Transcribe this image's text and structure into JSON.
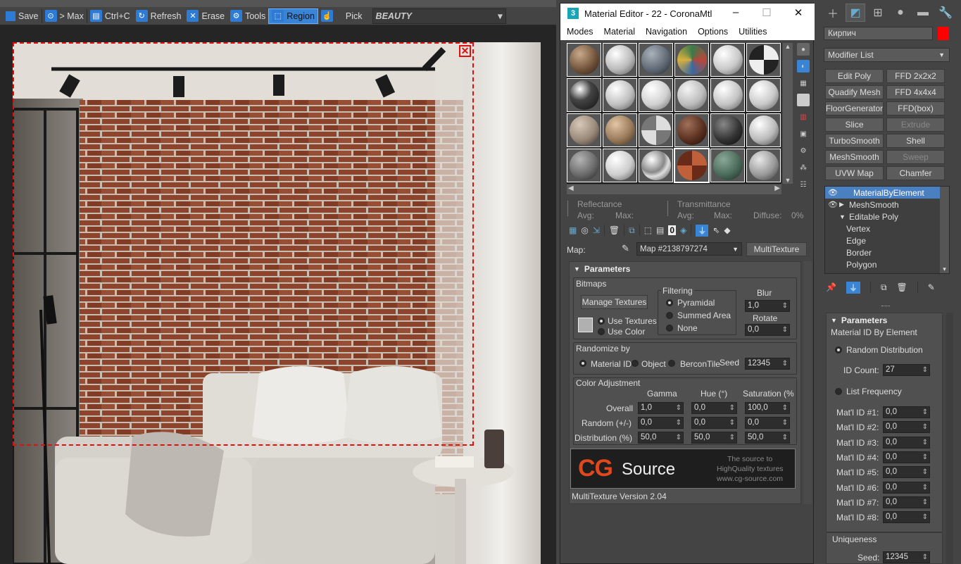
{
  "frame_buffer": {
    "toolbar": [
      {
        "label": "Save",
        "icon": "save-icon"
      },
      {
        "label": "> Max",
        "icon": "max-icon"
      },
      {
        "label": "Ctrl+C",
        "icon": "copy-icon"
      },
      {
        "label": "Refresh",
        "icon": "refresh-icon"
      },
      {
        "label": "Erase",
        "icon": "erase-icon"
      },
      {
        "label": "Tools",
        "icon": "tools-icon"
      },
      {
        "label": "Region",
        "icon": "region-icon",
        "selected": true
      },
      {
        "label": "Pick",
        "icon": "pick-icon"
      }
    ],
    "channel": "BEAUTY"
  },
  "material_editor": {
    "title": "Material Editor - 22 - CoronaMtl",
    "app_icon": "3",
    "menu": [
      "Modes",
      "Material",
      "Navigation",
      "Options",
      "Utilities"
    ],
    "reflectance": {
      "label": "Reflectance",
      "avg": "Avg:",
      "max": "Max:"
    },
    "transmittance": {
      "label": "Transmittance",
      "avg": "Avg:",
      "max": "Max:",
      "diffuse": "Diffuse:",
      "diffuse_val": "0%"
    },
    "map_label": "Map:",
    "map_name": "Map #2138797274",
    "map_type": "MultiTexture",
    "params": {
      "title": "Parameters",
      "bitmaps": "Bitmaps",
      "manage_textures": "Manage Textures",
      "use_textures": "Use Textures",
      "use_color": "Use Color",
      "filtering": "Filtering",
      "pyramidal": "Pyramidal",
      "summed_area": "Summed Area",
      "none": "None",
      "blur_label": "Blur",
      "blur": "1,0",
      "rotate_label": "Rotate",
      "rotate": "0,0",
      "randomize_by": "Randomize by",
      "material_id": "Material ID",
      "object": "Object",
      "bercontile": "BerconTile",
      "seed_label": "Seed",
      "seed": "12345",
      "color_adjustment": "Color Adjustment",
      "col_gamma": "Gamma",
      "col_hue": "Hue (°)",
      "col_sat": "Saturation (%",
      "rows": [
        {
          "label": "Overall",
          "g": "1,0",
          "h": "0,0",
          "s": "100,0"
        },
        {
          "label": "Random (+/-)",
          "g": "0,0",
          "h": "0,0",
          "s": "0,0"
        },
        {
          "label": "Distribution (%)",
          "g": "50,0",
          "h": "50,0",
          "s": "50,0"
        }
      ],
      "logo_cg": "CG",
      "logo_source": "Source",
      "logo_line1": "The source to",
      "logo_line2": "HighQuality textures",
      "logo_line3": "www.cg-source.com",
      "version": "MultiTexture Version 2.04"
    }
  },
  "command_panel": {
    "object_name": "Кирпич",
    "object_color": "#ff0000",
    "modifier_list": "Modifier List",
    "modifier_buttons": [
      {
        "label": "Edit Poly",
        "enabled": true
      },
      {
        "label": "FFD 2x2x2",
        "enabled": true
      },
      {
        "label": "Quadify Mesh",
        "enabled": true
      },
      {
        "label": "FFD 4x4x4",
        "enabled": true
      },
      {
        "label": "FloorGenerator",
        "enabled": true
      },
      {
        "label": "FFD(box)",
        "enabled": true
      },
      {
        "label": "Slice",
        "enabled": true
      },
      {
        "label": "Extrude",
        "enabled": false
      },
      {
        "label": "TurboSmooth",
        "enabled": true
      },
      {
        "label": "Shell",
        "enabled": true
      },
      {
        "label": "MeshSmooth",
        "enabled": true
      },
      {
        "label": "Sweep",
        "enabled": false
      },
      {
        "label": "UVW Map",
        "enabled": true
      },
      {
        "label": "Chamfer",
        "enabled": true
      }
    ],
    "stack": [
      {
        "label": "MaterialByElement",
        "level": 0,
        "selected": true,
        "eye": true
      },
      {
        "label": "MeshSmooth",
        "level": 0,
        "eye": true,
        "arrow": "▶"
      },
      {
        "label": "Editable Poly",
        "level": 0,
        "arrow": "▼"
      },
      {
        "label": "Vertex",
        "level": 1
      },
      {
        "label": "Edge",
        "level": 1
      },
      {
        "label": "Border",
        "level": 1
      },
      {
        "label": "Polygon",
        "level": 1
      }
    ],
    "params": {
      "title": "Parameters",
      "subtitle": "Material ID By Element",
      "random_distribution": "Random Distribution",
      "id_count_label": "ID Count:",
      "id_count": "27",
      "list_frequency": "List Frequency",
      "mat_ids": [
        {
          "label": "Mat'l ID #1:",
          "value": "0,0"
        },
        {
          "label": "Mat'l ID #2:",
          "value": "0,0"
        },
        {
          "label": "Mat'l ID #3:",
          "value": "0,0"
        },
        {
          "label": "Mat'l ID #4:",
          "value": "0,0"
        },
        {
          "label": "Mat'l ID #5:",
          "value": "0,0"
        },
        {
          "label": "Mat'l ID #6:",
          "value": "0,0"
        },
        {
          "label": "Mat'l ID #7:",
          "value": "0,0"
        },
        {
          "label": "Mat'l ID #8:",
          "value": "0,0"
        }
      ],
      "uniqueness": "Uniqueness",
      "seed_label": "Seed:",
      "seed": "12345"
    }
  }
}
